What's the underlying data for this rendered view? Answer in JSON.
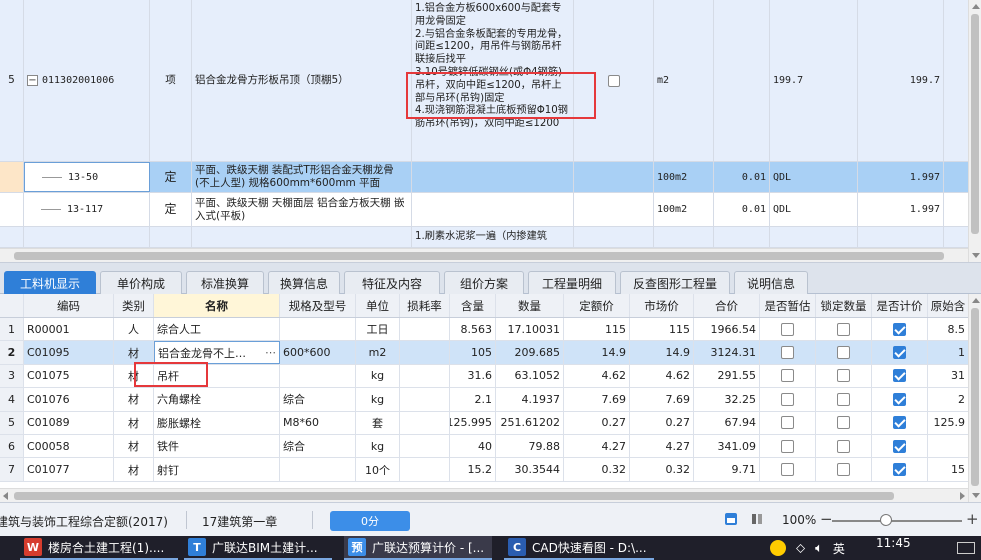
{
  "top_grid": {
    "row5": {
      "index": "5",
      "code": "011302001006",
      "type": "项",
      "name": "铝合金龙骨方形板吊顶（顶棚5）",
      "features": "1.铝合金方板600x600与配套专用龙骨固定\n2.与铝合金条板配套的专用龙骨，间距≤1200，用吊件与钢筋吊杆联接后找平\n3.10号镀锌低碳钢丝(或Φ4钢筋)吊杆，双向中距≤1200，吊杆上部与吊环(吊钩)固定\n4.现浇钢筋混凝土底板预留Φ10钢筋吊环(吊钩)，双向中距≤1200",
      "unit": "m2",
      "qty_expr": "199.7",
      "qty": "199.7"
    },
    "row_50": {
      "code": "13-50",
      "type": "定",
      "name": "平面、跌级天棚 装配式T形铝合金天棚龙骨(不上人型) 规格600mm*600mm 平面",
      "unit": "100m2",
      "qty_factor": "0.01",
      "qty_expr": "QDL",
      "qty": "1.997"
    },
    "row_117": {
      "code": "13-117",
      "type": "定",
      "name": "平面、跌级天棚 天棚面层 铝合金方板天棚 嵌入式(平板)",
      "unit": "100m2",
      "qty_factor": "0.01",
      "qty_expr": "QDL",
      "qty": "1.997"
    },
    "row_next": {
      "features": "1.刷素水泥浆一遍（内掺建筑"
    }
  },
  "tabs": [
    {
      "label": "工料机显示",
      "active": true
    },
    {
      "label": "单价构成"
    },
    {
      "label": "标准换算"
    },
    {
      "label": "换算信息"
    },
    {
      "label": "特征及内容"
    },
    {
      "label": "组价方案"
    },
    {
      "label": "工程量明细"
    },
    {
      "label": "反查图形工程量"
    },
    {
      "label": "说明信息"
    }
  ],
  "bottom_grid": {
    "headers": [
      "",
      "编码",
      "类别",
      "名称",
      "规格及型号",
      "单位",
      "损耗率",
      "含量",
      "数量",
      "定额价",
      "市场价",
      "合价",
      "是否暂估",
      "锁定数量",
      "是否计价",
      "原始含"
    ],
    "rows": [
      {
        "idx": "1",
        "code": "R00001",
        "cat": "人",
        "name": "综合人工",
        "spec": "",
        "unit": "工日",
        "loss": "",
        "content": "8.563",
        "qty": "17.10031",
        "quota": "115",
        "market": "115",
        "total": "1966.54",
        "est": false,
        "lock": false,
        "priced": true,
        "orig": "8.5"
      },
      {
        "idx": "2",
        "code": "C01095",
        "cat": "材",
        "name": "铝合金龙骨不上…",
        "spec": "600*600",
        "unit": "m2",
        "loss": "",
        "content": "105",
        "qty": "209.685",
        "quota": "14.9",
        "market": "14.9",
        "total": "3124.31",
        "est": false,
        "lock": false,
        "priced": true,
        "orig": "1"
      },
      {
        "idx": "3",
        "code": "C01075",
        "cat": "材",
        "name": "吊杆",
        "spec": "",
        "unit": "kg",
        "loss": "",
        "content": "31.6",
        "qty": "63.1052",
        "quota": "4.62",
        "market": "4.62",
        "total": "291.55",
        "est": false,
        "lock": false,
        "priced": true,
        "orig": "31"
      },
      {
        "idx": "4",
        "code": "C01076",
        "cat": "材",
        "name": "六角螺栓",
        "spec": "综合",
        "unit": "kg",
        "loss": "",
        "content": "2.1",
        "qty": "4.1937",
        "quota": "7.69",
        "market": "7.69",
        "total": "32.25",
        "est": false,
        "lock": false,
        "priced": true,
        "orig": "2"
      },
      {
        "idx": "5",
        "code": "C01089",
        "cat": "材",
        "name": "膨胀螺栓",
        "spec": "M8*60",
        "unit": "套",
        "loss": "",
        "content": "125.995",
        "qty": "251.61202",
        "quota": "0.27",
        "market": "0.27",
        "total": "67.94",
        "est": false,
        "lock": false,
        "priced": true,
        "orig": "125.9"
      },
      {
        "idx": "6",
        "code": "C00058",
        "cat": "材",
        "name": "铁件",
        "spec": "综合",
        "unit": "kg",
        "loss": "",
        "content": "40",
        "qty": "79.88",
        "quota": "4.27",
        "market": "4.27",
        "total": "341.09",
        "est": false,
        "lock": false,
        "priced": true,
        "orig": ""
      },
      {
        "idx": "7",
        "code": "C01077",
        "cat": "材",
        "name": "射钉",
        "spec": "",
        "unit": "10个",
        "loss": "",
        "content": "15.2",
        "qty": "30.3544",
        "quota": "0.32",
        "market": "0.32",
        "total": "9.71",
        "est": false,
        "lock": false,
        "priced": true,
        "orig": "15"
      }
    ]
  },
  "status_bar": {
    "quota_lib": "建筑与装饰工程综合定额(2017)",
    "chapter": "17建筑第一章",
    "button": "0分",
    "zoom": "100%"
  },
  "taskbar": {
    "items": [
      "楼房合土建工程(1)....",
      "广联达BIM土建计...",
      "广联达预算计价 - [...",
      "CAD快速看图 - D:\\..."
    ],
    "time": "11:45",
    "ime": "英"
  },
  "colors": {
    "accent": "#2f7fd8",
    "selected_row": "#a9d0f5",
    "highlight_box": "#e5383b"
  }
}
